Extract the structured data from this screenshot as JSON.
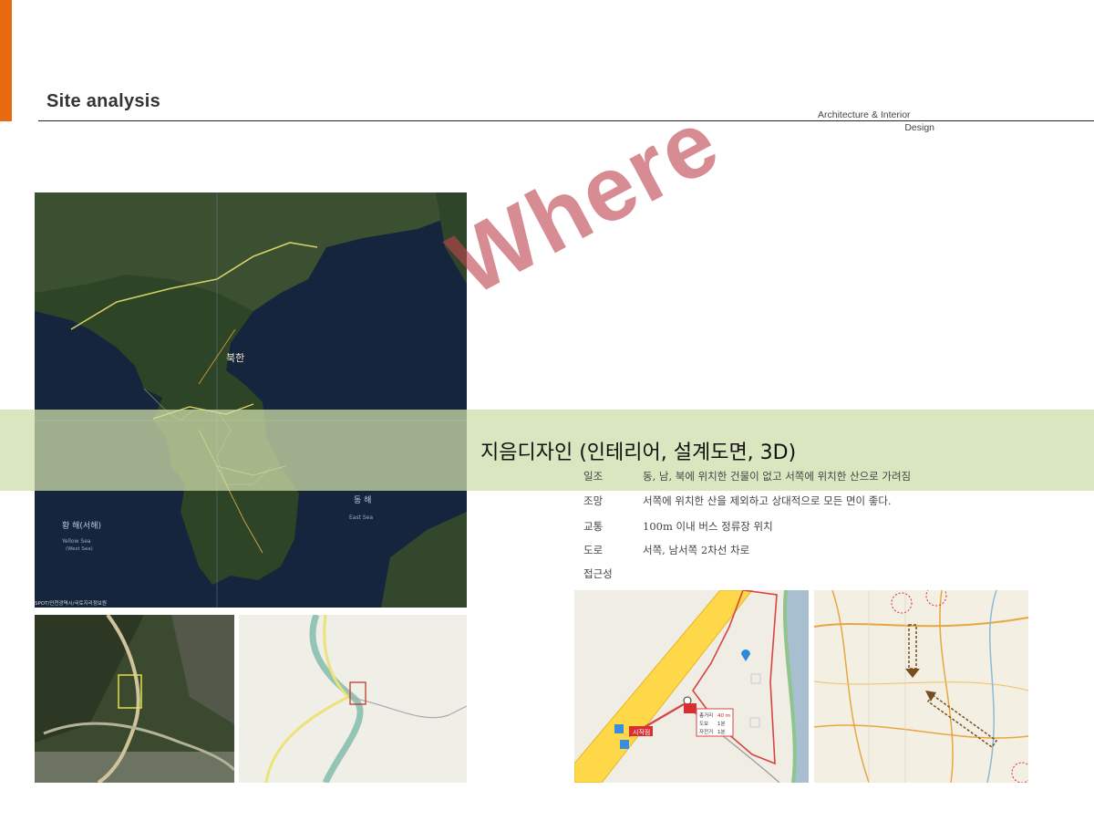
{
  "header": {
    "title": "Site analysis",
    "brand_line1": "Architecture  &  Interior",
    "brand_line2": "Design"
  },
  "overlay": {
    "where_text": "Where",
    "band_text": "지음디자인 (인테리어, 설계도면, 3D)"
  },
  "site_info": [
    {
      "label": "일조",
      "value": "동, 남, 북에 위치한 건물이 없고 서쪽에 위치한 산으로 가려짐"
    },
    {
      "label": "조망",
      "value": "서쪽에 위치한 산을 제외하고 상대적으로 모든 면이 좋다."
    },
    {
      "label": "교통",
      "value": "100m 이내 버스 정류장 위치"
    },
    {
      "label": "도로",
      "value": "서쪽, 남서쪽 2차선 차로"
    },
    {
      "label": "접근성",
      "value": ""
    }
  ],
  "korea_map": {
    "label_north": "북한",
    "label_east_sea": "동  해",
    "label_east_sea_en": "East Sea",
    "label_yellow_sea": "황  해(서해)",
    "label_yellow_sea_en": "Yellow Sea",
    "label_west_sea_en": "(West Sea)",
    "credit": "SPOT/인천광역시/국토지리정보원"
  },
  "route_map": {
    "start_label": "시작점",
    "distance_key": "총거리",
    "distance_val": "40 m",
    "walk_key": "도보",
    "walk_val": "1분",
    "bike_key": "자전거",
    "bike_val": "1분"
  },
  "colors": {
    "accent": "#e86a10",
    "where": "#be4650",
    "band": "#cddeaa"
  }
}
